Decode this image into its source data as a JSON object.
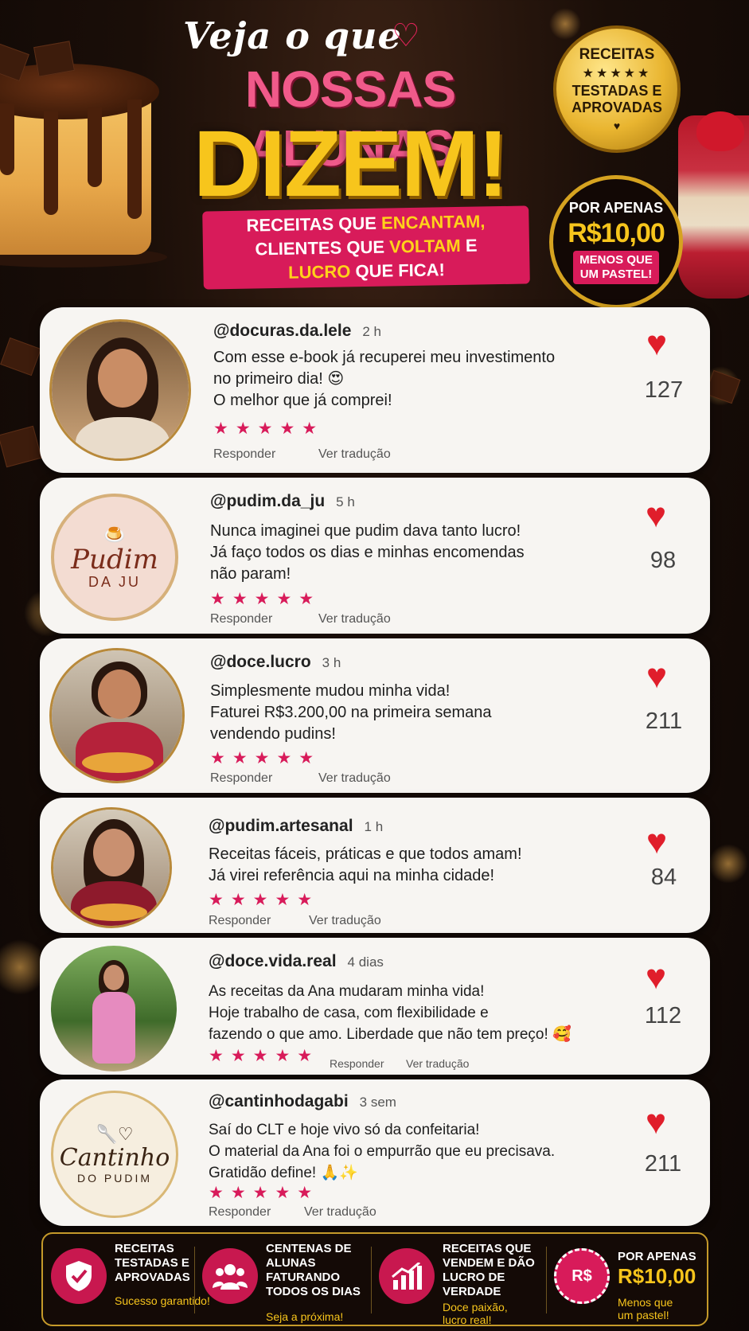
{
  "header": {
    "script_title": "Veja o que",
    "main_title": "NOSSAS ALUNAS",
    "big_title": "DIZEM!",
    "tagline": {
      "line1_a": "RECEITAS QUE ",
      "line1_b": "ENCANTAM,",
      "line2_a": "CLIENTES QUE ",
      "line2_b": "VOLTAM",
      "line2_c": " E",
      "line3_a": "LUCRO",
      "line3_b": " QUE FICA!"
    },
    "seal": {
      "line1": "RECEITAS",
      "stars": "★★★★★",
      "line2": "TESTADAS E",
      "line3": "APROVADAS"
    },
    "price_badge": {
      "top": "POR APENAS",
      "price": "R$10,00",
      "bottom1": "MENOS QUE",
      "bottom2": "UM PASTEL!"
    }
  },
  "comments": [
    {
      "handle": "@docuras.da.lele",
      "time": "2 h",
      "lines": [
        "Com esse e-book já recuperei meu investimento",
        "no primeiro dia! 😍",
        "O melhor que já comprei!"
      ],
      "stars": "★★★★★",
      "reply": "Responder",
      "translate": "Ver tradução",
      "likes": "127"
    },
    {
      "handle": "@pudim.da_ju",
      "time": "5 h",
      "lines": [
        "Nunca imaginei que pudim dava tanto lucro!",
        "Já faço todos os dias e minhas encomendas",
        "não param!"
      ],
      "stars": "★★★★★",
      "reply": "Responder",
      "translate": "Ver tradução",
      "likes": "98",
      "logo": {
        "name": "Pudim",
        "sub": "DA JU"
      }
    },
    {
      "handle": "@doce.lucro",
      "time": "3 h",
      "lines": [
        "Simplesmente mudou minha vida!",
        "Faturei R$3.200,00 na primeira semana",
        "vendendo pudins!"
      ],
      "stars": "★★★★★",
      "reply": "Responder",
      "translate": "Ver tradução",
      "likes": "211"
    },
    {
      "handle": "@pudim.artesanal",
      "time": "1 h",
      "lines": [
        "Receitas fáceis, práticas e que todos amam!",
        "Já virei referência aqui na minha cidade!"
      ],
      "stars": "★★★★★",
      "reply": "Responder",
      "translate": "Ver tradução",
      "likes": "84"
    },
    {
      "handle": "@doce.vida.real",
      "time": "4 dias",
      "lines": [
        "As receitas da Ana mudaram minha vida!",
        "Hoje trabalho de casa, com flexibilidade e",
        "fazendo o que amo. Liberdade que não tem preço! 🥰"
      ],
      "stars": "★★★★★",
      "reply": "Responder",
      "translate": "Ver tradução",
      "likes": "112"
    },
    {
      "handle": "@cantinhodagabi",
      "time": "3 sem",
      "lines": [
        "Saí do CLT e hoje vivo só da confeitaria!",
        "O material da Ana foi o empurrão que eu precisava.",
        "Gratidão define! 🙏✨"
      ],
      "stars": "★★★★★",
      "reply": "Responder",
      "translate": "Ver tradução",
      "likes": "211",
      "logo": {
        "name": "Cantinho",
        "sub": "DO PUDIM"
      }
    }
  ],
  "footer": [
    {
      "icon": "shield-check-icon",
      "title": "RECEITAS TESTADAS E APROVADAS",
      "sub": "Sucesso garantido!"
    },
    {
      "icon": "people-icon",
      "title": "CENTENAS DE ALUNAS FATURANDO TODOS OS DIAS",
      "sub": "Seja a próxima!"
    },
    {
      "icon": "chart-up-icon",
      "title": "RECEITAS QUE VENDEM E DÃO LUCRO DE VERDADE",
      "sub": "Doce paixão, lucro real!"
    },
    {
      "icon": "money-badge-icon",
      "title_top": "POR APENAS",
      "price": "R$10,00",
      "sub": "Menos que um pastel!",
      "icon_text": "R$"
    }
  ],
  "colors": {
    "accent_pink": "#d81b5a",
    "gold": "#f7c51c",
    "heart_red": "#e01e2b",
    "card_bg": "#f7f5f2"
  }
}
